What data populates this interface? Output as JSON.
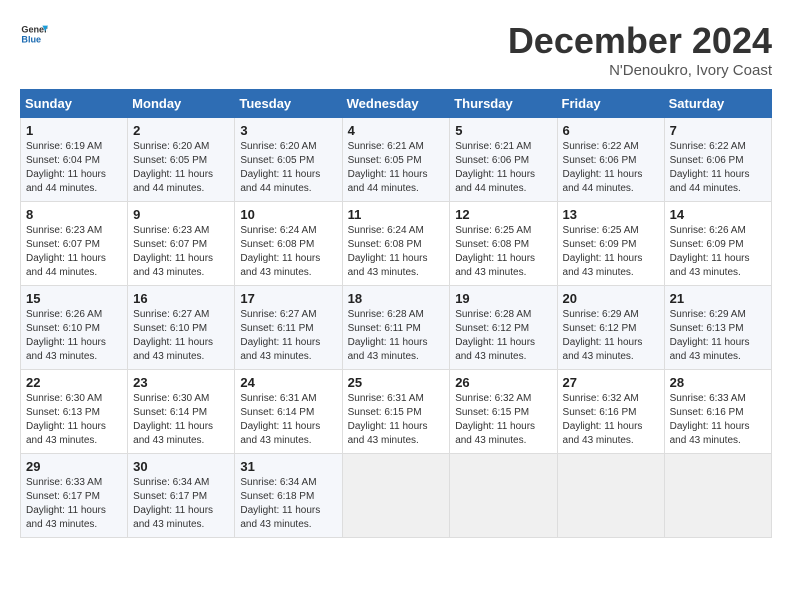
{
  "logo": {
    "text_general": "General",
    "text_blue": "Blue"
  },
  "header": {
    "month": "December 2024",
    "location": "N'Denoukro, Ivory Coast"
  },
  "days_of_week": [
    "Sunday",
    "Monday",
    "Tuesday",
    "Wednesday",
    "Thursday",
    "Friday",
    "Saturday"
  ],
  "weeks": [
    [
      {
        "day": "1",
        "sunrise": "6:19 AM",
        "sunset": "6:04 PM",
        "daylight": "11 hours and 44 minutes."
      },
      {
        "day": "2",
        "sunrise": "6:20 AM",
        "sunset": "6:05 PM",
        "daylight": "11 hours and 44 minutes."
      },
      {
        "day": "3",
        "sunrise": "6:20 AM",
        "sunset": "6:05 PM",
        "daylight": "11 hours and 44 minutes."
      },
      {
        "day": "4",
        "sunrise": "6:21 AM",
        "sunset": "6:05 PM",
        "daylight": "11 hours and 44 minutes."
      },
      {
        "day": "5",
        "sunrise": "6:21 AM",
        "sunset": "6:06 PM",
        "daylight": "11 hours and 44 minutes."
      },
      {
        "day": "6",
        "sunrise": "6:22 AM",
        "sunset": "6:06 PM",
        "daylight": "11 hours and 44 minutes."
      },
      {
        "day": "7",
        "sunrise": "6:22 AM",
        "sunset": "6:06 PM",
        "daylight": "11 hours and 44 minutes."
      }
    ],
    [
      {
        "day": "8",
        "sunrise": "6:23 AM",
        "sunset": "6:07 PM",
        "daylight": "11 hours and 44 minutes."
      },
      {
        "day": "9",
        "sunrise": "6:23 AM",
        "sunset": "6:07 PM",
        "daylight": "11 hours and 43 minutes."
      },
      {
        "day": "10",
        "sunrise": "6:24 AM",
        "sunset": "6:08 PM",
        "daylight": "11 hours and 43 minutes."
      },
      {
        "day": "11",
        "sunrise": "6:24 AM",
        "sunset": "6:08 PM",
        "daylight": "11 hours and 43 minutes."
      },
      {
        "day": "12",
        "sunrise": "6:25 AM",
        "sunset": "6:08 PM",
        "daylight": "11 hours and 43 minutes."
      },
      {
        "day": "13",
        "sunrise": "6:25 AM",
        "sunset": "6:09 PM",
        "daylight": "11 hours and 43 minutes."
      },
      {
        "day": "14",
        "sunrise": "6:26 AM",
        "sunset": "6:09 PM",
        "daylight": "11 hours and 43 minutes."
      }
    ],
    [
      {
        "day": "15",
        "sunrise": "6:26 AM",
        "sunset": "6:10 PM",
        "daylight": "11 hours and 43 minutes."
      },
      {
        "day": "16",
        "sunrise": "6:27 AM",
        "sunset": "6:10 PM",
        "daylight": "11 hours and 43 minutes."
      },
      {
        "day": "17",
        "sunrise": "6:27 AM",
        "sunset": "6:11 PM",
        "daylight": "11 hours and 43 minutes."
      },
      {
        "day": "18",
        "sunrise": "6:28 AM",
        "sunset": "6:11 PM",
        "daylight": "11 hours and 43 minutes."
      },
      {
        "day": "19",
        "sunrise": "6:28 AM",
        "sunset": "6:12 PM",
        "daylight": "11 hours and 43 minutes."
      },
      {
        "day": "20",
        "sunrise": "6:29 AM",
        "sunset": "6:12 PM",
        "daylight": "11 hours and 43 minutes."
      },
      {
        "day": "21",
        "sunrise": "6:29 AM",
        "sunset": "6:13 PM",
        "daylight": "11 hours and 43 minutes."
      }
    ],
    [
      {
        "day": "22",
        "sunrise": "6:30 AM",
        "sunset": "6:13 PM",
        "daylight": "11 hours and 43 minutes."
      },
      {
        "day": "23",
        "sunrise": "6:30 AM",
        "sunset": "6:14 PM",
        "daylight": "11 hours and 43 minutes."
      },
      {
        "day": "24",
        "sunrise": "6:31 AM",
        "sunset": "6:14 PM",
        "daylight": "11 hours and 43 minutes."
      },
      {
        "day": "25",
        "sunrise": "6:31 AM",
        "sunset": "6:15 PM",
        "daylight": "11 hours and 43 minutes."
      },
      {
        "day": "26",
        "sunrise": "6:32 AM",
        "sunset": "6:15 PM",
        "daylight": "11 hours and 43 minutes."
      },
      {
        "day": "27",
        "sunrise": "6:32 AM",
        "sunset": "6:16 PM",
        "daylight": "11 hours and 43 minutes."
      },
      {
        "day": "28",
        "sunrise": "6:33 AM",
        "sunset": "6:16 PM",
        "daylight": "11 hours and 43 minutes."
      }
    ],
    [
      {
        "day": "29",
        "sunrise": "6:33 AM",
        "sunset": "6:17 PM",
        "daylight": "11 hours and 43 minutes."
      },
      {
        "day": "30",
        "sunrise": "6:34 AM",
        "sunset": "6:17 PM",
        "daylight": "11 hours and 43 minutes."
      },
      {
        "day": "31",
        "sunrise": "6:34 AM",
        "sunset": "6:18 PM",
        "daylight": "11 hours and 43 minutes."
      },
      null,
      null,
      null,
      null
    ]
  ],
  "labels": {
    "sunrise": "Sunrise: ",
    "sunset": "Sunset: ",
    "daylight": "Daylight: "
  }
}
